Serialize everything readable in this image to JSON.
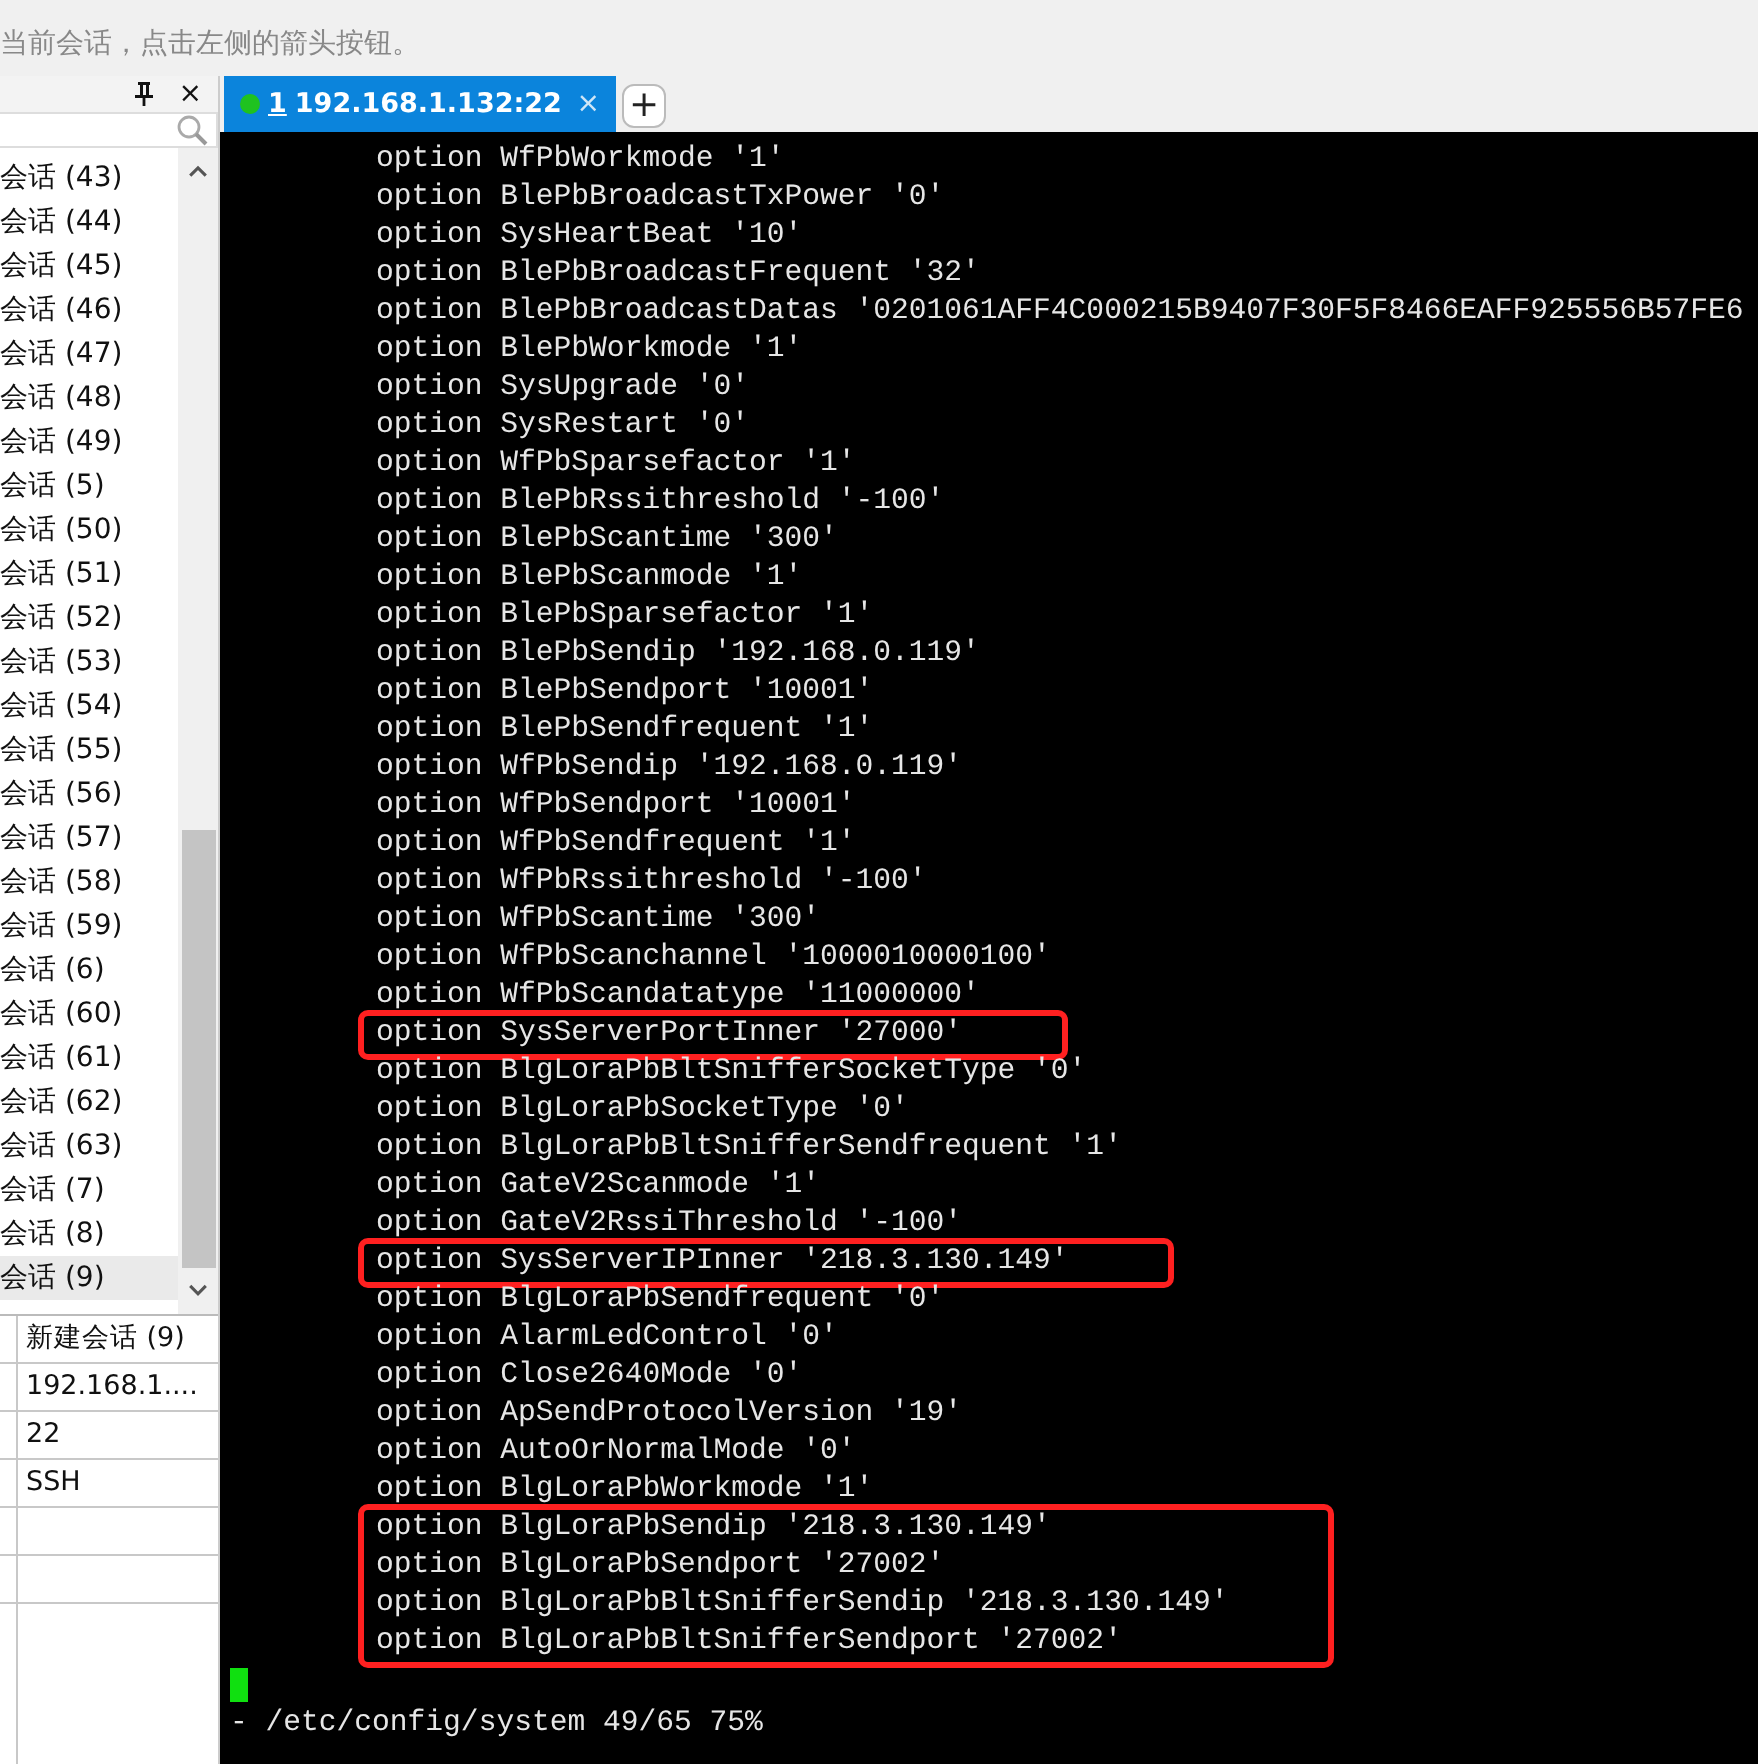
{
  "hint_bar": {
    "text": "当前会话，点击左侧的箭头按钮。"
  },
  "session_panel": {
    "items": [
      {
        "label": "会话 (43)",
        "selected": false
      },
      {
        "label": "会话 (44)",
        "selected": false
      },
      {
        "label": "会话 (45)",
        "selected": false
      },
      {
        "label": "会话 (46)",
        "selected": false
      },
      {
        "label": "会话 (47)",
        "selected": false
      },
      {
        "label": "会话 (48)",
        "selected": false
      },
      {
        "label": "会话 (49)",
        "selected": false
      },
      {
        "label": "会话 (5)",
        "selected": false
      },
      {
        "label": "会话 (50)",
        "selected": false
      },
      {
        "label": "会话 (51)",
        "selected": false
      },
      {
        "label": "会话 (52)",
        "selected": false
      },
      {
        "label": "会话 (53)",
        "selected": false
      },
      {
        "label": "会话 (54)",
        "selected": false
      },
      {
        "label": "会话 (55)",
        "selected": false
      },
      {
        "label": "会话 (56)",
        "selected": false
      },
      {
        "label": "会话 (57)",
        "selected": false
      },
      {
        "label": "会话 (58)",
        "selected": false
      },
      {
        "label": "会话 (59)",
        "selected": false
      },
      {
        "label": "会话 (6)",
        "selected": false
      },
      {
        "label": "会话 (60)",
        "selected": false
      },
      {
        "label": "会话 (61)",
        "selected": false
      },
      {
        "label": "会话 (62)",
        "selected": false
      },
      {
        "label": "会话 (63)",
        "selected": false
      },
      {
        "label": "会话 (7)",
        "selected": false
      },
      {
        "label": "会话 (8)",
        "selected": false
      },
      {
        "label": "会话 (9)",
        "selected": true
      }
    ],
    "properties": [
      "新建会话 (9)",
      "192.168.1....",
      "22",
      "SSH"
    ],
    "close_glyph": "×"
  },
  "tabs": [
    {
      "number": "1",
      "label": "192.168.1.132:22",
      "selected": true,
      "connected": true,
      "close_glyph": "×"
    }
  ],
  "new_tab_glyph": "+",
  "terminal": {
    "lines": [
      {
        "text": "option WfPbWorkmode '1'",
        "highlighted": false
      },
      {
        "text": "option BlePbBroadcastTxPower '0'",
        "highlighted": false
      },
      {
        "text": "option SysHeartBeat '10'",
        "highlighted": false
      },
      {
        "text": "option BlePbBroadcastFrequent '32'",
        "highlighted": false
      },
      {
        "text": "option BlePbBroadcastDatas '0201061AFF4C000215B9407F30F5F8466EAFF925556B57FE6",
        "highlighted": false
      },
      {
        "text": "option BlePbWorkmode '1'",
        "highlighted": false
      },
      {
        "text": "option SysUpgrade '0'",
        "highlighted": false
      },
      {
        "text": "option SysRestart '0'",
        "highlighted": false
      },
      {
        "text": "option WfPbSparsefactor '1'",
        "highlighted": false
      },
      {
        "text": "option BlePbRssithreshold '-100'",
        "highlighted": false
      },
      {
        "text": "option BlePbScantime '300'",
        "highlighted": false
      },
      {
        "text": "option BlePbScanmode '1'",
        "highlighted": false
      },
      {
        "text": "option BlePbSparsefactor '1'",
        "highlighted": false
      },
      {
        "text": "option BlePbSendip '192.168.0.119'",
        "highlighted": false
      },
      {
        "text": "option BlePbSendport '10001'",
        "highlighted": false
      },
      {
        "text": "option BlePbSendfrequent '1'",
        "highlighted": false
      },
      {
        "text": "option WfPbSendip '192.168.0.119'",
        "highlighted": false
      },
      {
        "text": "option WfPbSendport '10001'",
        "highlighted": false
      },
      {
        "text": "option WfPbSendfrequent '1'",
        "highlighted": false
      },
      {
        "text": "option WfPbRssithreshold '-100'",
        "highlighted": false
      },
      {
        "text": "option WfPbScantime '300'",
        "highlighted": false
      },
      {
        "text": "option WfPbScanchannel '1000010000100'",
        "highlighted": false
      },
      {
        "text": "option WfPbScandatatype '11000000'",
        "highlighted": false
      },
      {
        "text": "option SysServerPortInner '27000'",
        "highlighted": true
      },
      {
        "text": "option BlgLoraPbBltSnifferSocketType '0'",
        "highlighted": false
      },
      {
        "text": "option BlgLoraPbSocketType '0'",
        "highlighted": false
      },
      {
        "text": "option BlgLoraPbBltSnifferSendfrequent '1'",
        "highlighted": false
      },
      {
        "text": "option GateV2Scanmode '1'",
        "highlighted": false
      },
      {
        "text": "option GateV2RssiThreshold '-100'",
        "highlighted": false
      },
      {
        "text": "option SysServerIPInner '218.3.130.149'",
        "highlighted": true
      },
      {
        "text": "option BlgLoraPbSendfrequent '0'",
        "highlighted": false
      },
      {
        "text": "option AlarmLedControl '0'",
        "highlighted": false
      },
      {
        "text": "option Close2640Mode '0'",
        "highlighted": false
      },
      {
        "text": "option ApSendProtocolVersion '19'",
        "highlighted": false
      },
      {
        "text": "option AutoOrNormalMode '0'",
        "highlighted": false
      },
      {
        "text": "option BlgLoraPbWorkmode '1'",
        "highlighted": false
      },
      {
        "text": "option BlgLoraPbSendip '218.3.130.149'",
        "highlighted": true
      },
      {
        "text": "option BlgLoraPbSendport '27002'",
        "highlighted": true
      },
      {
        "text": "option BlgLoraPbBltSnifferSendip '218.3.130.149'",
        "highlighted": true
      },
      {
        "text": "option BlgLoraPbBltSnifferSendport '27002'",
        "highlighted": true
      }
    ],
    "status_line": "- /etc/config/system 49/65 75%"
  }
}
